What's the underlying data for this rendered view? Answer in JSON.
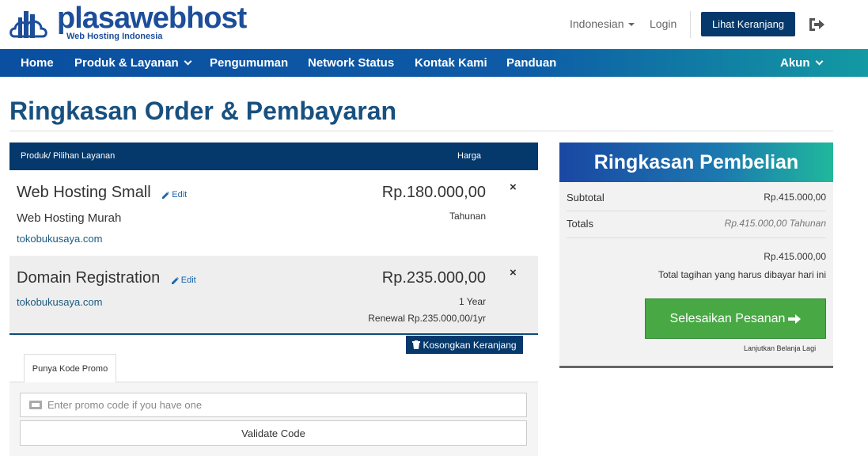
{
  "brand": {
    "name": "plasawebhost",
    "tagline": "Web Hosting Indonesia"
  },
  "header": {
    "language": "Indonesian",
    "login": "Login",
    "cart_button": "Lihat Keranjang"
  },
  "nav": {
    "items": [
      "Home",
      "Produk & Layanan",
      "Pengumuman",
      "Network Status",
      "Kontak Kami",
      "Panduan"
    ],
    "account": "Akun"
  },
  "page": {
    "title": "Ringkasan Order & Pembayaran"
  },
  "cart": {
    "headers": {
      "product": "Produk/ Pilihan Layanan",
      "price": "Harga"
    },
    "items": [
      {
        "name": "Web Hosting Small",
        "edit": "Edit",
        "subtitle": "Web Hosting Murah",
        "domain": "tokobukusaya.com",
        "price": "Rp.180.000,00",
        "cycle": "Tahunan",
        "remove": "×"
      },
      {
        "name": "Domain Registration",
        "edit": "Edit",
        "domain": "tokobukusaya.com",
        "price": "Rp.235.000,00",
        "cycle": "1 Year",
        "renewal": "Renewal Rp.235.000,00/1yr",
        "remove": "×"
      }
    ],
    "empty_button": "Kosongkan Keranjang"
  },
  "promo": {
    "tab": "Punya Kode Promo",
    "placeholder": "Enter promo code if you have one",
    "validate": "Validate Code"
  },
  "summary": {
    "title": "Ringkasan Pembelian",
    "subtotal_label": "Subtotal",
    "subtotal_value": "Rp.415.000,00",
    "totals_label": "Totals",
    "totals_value": "Rp.415.000,00 Tahunan",
    "due_amount": "Rp.415.000,00",
    "due_label": "Total tagihan yang harus dibayar hari ini",
    "checkout_button": "Selesaikan Pesanan",
    "continue_link": "Lanjutkan Belanja Lagi"
  },
  "colors": {
    "primary": "#05386b",
    "title": "#18507f",
    "success": "#48a944"
  }
}
